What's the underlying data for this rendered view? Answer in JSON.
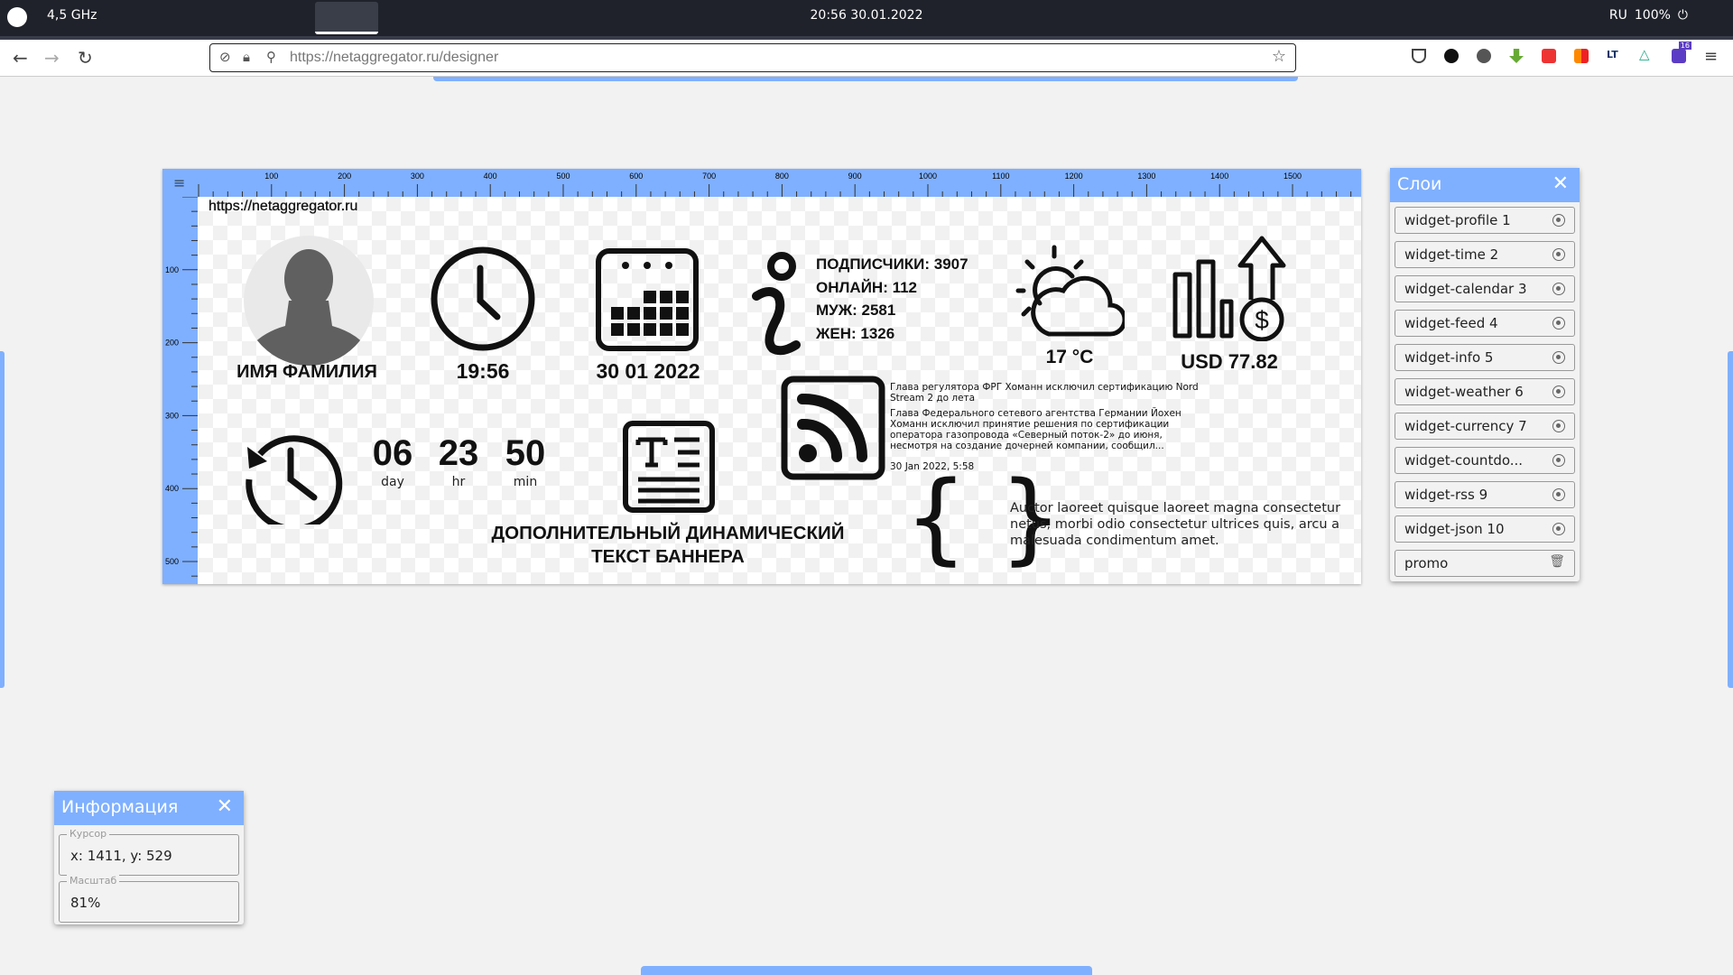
{
  "system_bar": {
    "cpu": "4,5 GHz",
    "datetime": "20:56 30.01.2022",
    "lang": "RU",
    "battery": "100%"
  },
  "browser": {
    "url": "https://netaggregator.ru/designer",
    "ext_badge": "16"
  },
  "ruler": {
    "x_ticks": [
      "100",
      "200",
      "300",
      "400",
      "500",
      "600",
      "700",
      "800",
      "900",
      "1000",
      "1100",
      "1200",
      "1300",
      "1400",
      "1500"
    ],
    "y_ticks": [
      "100",
      "200",
      "300",
      "400",
      "500"
    ]
  },
  "banner": {
    "site": "https://netaggregator.ru",
    "profile_name": "ИМЯ ФАМИЛИЯ",
    "time": "19:56",
    "date": "30 01 2022",
    "info": [
      "ПОДПИСЧИКИ: 3907",
      "ОНЛАЙН: 112",
      "МУЖ: 2581",
      "ЖЕН: 1326"
    ],
    "weather": "17 °C",
    "currency": "USD 77.82",
    "feed": {
      "title": "Глава регулятора ФРГ Хоманн исключил сертификацию Nord Stream 2 до лета",
      "body": "Глава Федерального сетевого агентства Германии Йохен Хоманн исключил принятие решения по сертификации оператора газопровода «Северный поток-2» до июня, несмотря на создание дочерней компании, сообщил...",
      "date": "30 Jan 2022, 5:58"
    },
    "countdown": {
      "days": "06",
      "hours": "23",
      "minutes": "50",
      "day_label": "day",
      "hr_label": "hr",
      "min_label": "min"
    },
    "dynamic_text": [
      "ДОПОЛНИТЕЛЬНЫЙ ДИНАМИЧЕСКИЙ",
      "ТЕКСТ БАННЕРА"
    ],
    "json_text": "Auctor laoreet quisque laoreet magna consectetur netus, morbi odio consectetur ultrices quis, arcu a malesuada condimentum amet."
  },
  "layers_panel": {
    "title": "Слои",
    "items": [
      "widget-profile 1",
      "widget-time 2",
      "widget-calendar 3",
      "widget-feed 4",
      "widget-info 5",
      "widget-weather 6",
      "widget-currency 7",
      "widget-countdo...",
      "widget-rss 9",
      "widget-json 10",
      "promo"
    ]
  },
  "info_panel": {
    "title": "Информация",
    "cursor_label": "Курсор",
    "cursor_value": "x: 1411, y: 529",
    "scale_label": "Масштаб",
    "scale_value": "81%"
  },
  "colors": {
    "accent": "#7fb0ff",
    "topbar": "#1f222a"
  }
}
